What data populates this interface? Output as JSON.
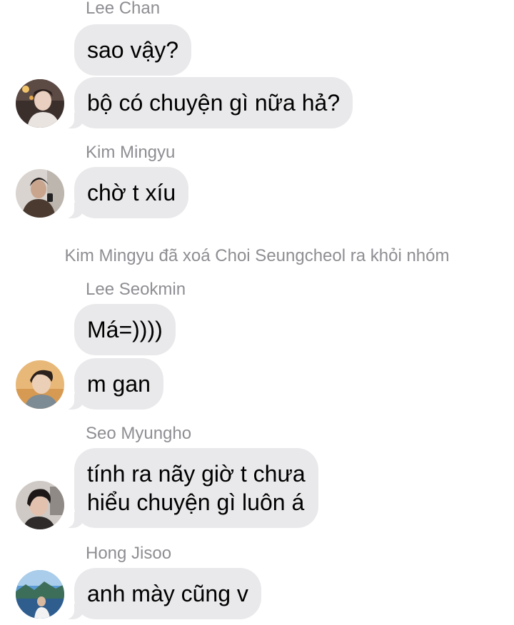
{
  "conversation": {
    "block1": {
      "sender": "Lee Chan",
      "messages": [
        "sao vậy?",
        "bộ có chuyện gì nữa hả?"
      ],
      "avatar_icon": "avatar-lee-chan-icon"
    },
    "block2": {
      "sender": "Kim Mingyu",
      "messages": [
        "chờ t xíu"
      ],
      "avatar_icon": "avatar-kim-mingyu-icon"
    },
    "system_message": "Kim Mingyu đã xoá Choi Seungcheol ra khỏi nhóm",
    "block3": {
      "sender": "Lee Seokmin",
      "messages": [
        "Má=))))",
        "m gan"
      ],
      "avatar_icon": "avatar-lee-seokmin-icon"
    },
    "block4": {
      "sender": "Seo Myungho",
      "messages": [
        "tính ra nãy giờ t chưa",
        "hiểu chuyện gì luôn á"
      ],
      "avatar_icon": "avatar-seo-myungho-icon"
    },
    "block5": {
      "sender": "Hong Jisoo",
      "messages": [
        "anh mày cũng v"
      ],
      "avatar_icon": "avatar-hong-jisoo-icon"
    }
  },
  "colors": {
    "bubble_bg": "#e9e9eb",
    "meta_text": "#8e8e93",
    "message_text": "#000000",
    "background": "#ffffff"
  }
}
